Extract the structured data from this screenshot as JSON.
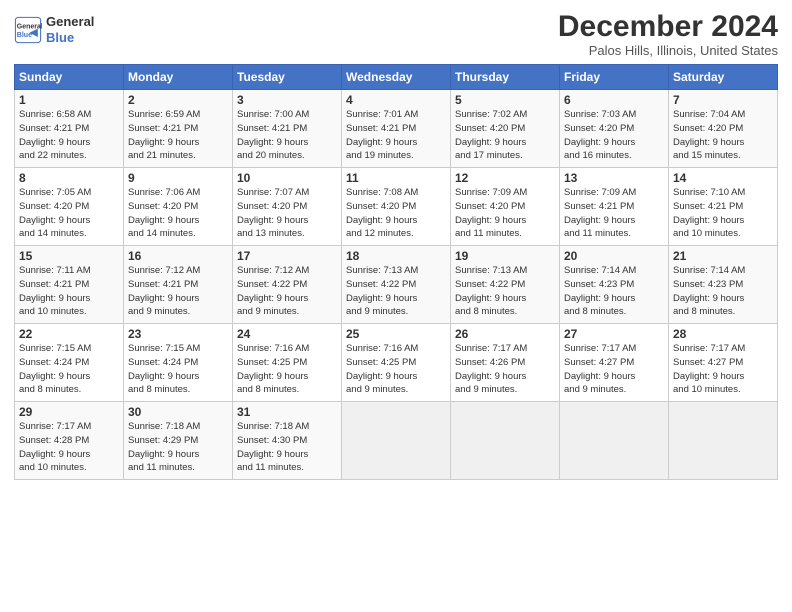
{
  "header": {
    "logo_line1": "General",
    "logo_line2": "Blue",
    "title": "December 2024",
    "location": "Palos Hills, Illinois, United States"
  },
  "days_of_week": [
    "Sunday",
    "Monday",
    "Tuesday",
    "Wednesday",
    "Thursday",
    "Friday",
    "Saturday"
  ],
  "weeks": [
    [
      {
        "day": "1",
        "info": "Sunrise: 6:58 AM\nSunset: 4:21 PM\nDaylight: 9 hours\nand 22 minutes."
      },
      {
        "day": "2",
        "info": "Sunrise: 6:59 AM\nSunset: 4:21 PM\nDaylight: 9 hours\nand 21 minutes."
      },
      {
        "day": "3",
        "info": "Sunrise: 7:00 AM\nSunset: 4:21 PM\nDaylight: 9 hours\nand 20 minutes."
      },
      {
        "day": "4",
        "info": "Sunrise: 7:01 AM\nSunset: 4:21 PM\nDaylight: 9 hours\nand 19 minutes."
      },
      {
        "day": "5",
        "info": "Sunrise: 7:02 AM\nSunset: 4:20 PM\nDaylight: 9 hours\nand 17 minutes."
      },
      {
        "day": "6",
        "info": "Sunrise: 7:03 AM\nSunset: 4:20 PM\nDaylight: 9 hours\nand 16 minutes."
      },
      {
        "day": "7",
        "info": "Sunrise: 7:04 AM\nSunset: 4:20 PM\nDaylight: 9 hours\nand 15 minutes."
      }
    ],
    [
      {
        "day": "8",
        "info": "Sunrise: 7:05 AM\nSunset: 4:20 PM\nDaylight: 9 hours\nand 14 minutes."
      },
      {
        "day": "9",
        "info": "Sunrise: 7:06 AM\nSunset: 4:20 PM\nDaylight: 9 hours\nand 14 minutes."
      },
      {
        "day": "10",
        "info": "Sunrise: 7:07 AM\nSunset: 4:20 PM\nDaylight: 9 hours\nand 13 minutes."
      },
      {
        "day": "11",
        "info": "Sunrise: 7:08 AM\nSunset: 4:20 PM\nDaylight: 9 hours\nand 12 minutes."
      },
      {
        "day": "12",
        "info": "Sunrise: 7:09 AM\nSunset: 4:20 PM\nDaylight: 9 hours\nand 11 minutes."
      },
      {
        "day": "13",
        "info": "Sunrise: 7:09 AM\nSunset: 4:21 PM\nDaylight: 9 hours\nand 11 minutes."
      },
      {
        "day": "14",
        "info": "Sunrise: 7:10 AM\nSunset: 4:21 PM\nDaylight: 9 hours\nand 10 minutes."
      }
    ],
    [
      {
        "day": "15",
        "info": "Sunrise: 7:11 AM\nSunset: 4:21 PM\nDaylight: 9 hours\nand 10 minutes."
      },
      {
        "day": "16",
        "info": "Sunrise: 7:12 AM\nSunset: 4:21 PM\nDaylight: 9 hours\nand 9 minutes."
      },
      {
        "day": "17",
        "info": "Sunrise: 7:12 AM\nSunset: 4:22 PM\nDaylight: 9 hours\nand 9 minutes."
      },
      {
        "day": "18",
        "info": "Sunrise: 7:13 AM\nSunset: 4:22 PM\nDaylight: 9 hours\nand 9 minutes."
      },
      {
        "day": "19",
        "info": "Sunrise: 7:13 AM\nSunset: 4:22 PM\nDaylight: 9 hours\nand 8 minutes."
      },
      {
        "day": "20",
        "info": "Sunrise: 7:14 AM\nSunset: 4:23 PM\nDaylight: 9 hours\nand 8 minutes."
      },
      {
        "day": "21",
        "info": "Sunrise: 7:14 AM\nSunset: 4:23 PM\nDaylight: 9 hours\nand 8 minutes."
      }
    ],
    [
      {
        "day": "22",
        "info": "Sunrise: 7:15 AM\nSunset: 4:24 PM\nDaylight: 9 hours\nand 8 minutes."
      },
      {
        "day": "23",
        "info": "Sunrise: 7:15 AM\nSunset: 4:24 PM\nDaylight: 9 hours\nand 8 minutes."
      },
      {
        "day": "24",
        "info": "Sunrise: 7:16 AM\nSunset: 4:25 PM\nDaylight: 9 hours\nand 8 minutes."
      },
      {
        "day": "25",
        "info": "Sunrise: 7:16 AM\nSunset: 4:25 PM\nDaylight: 9 hours\nand 9 minutes."
      },
      {
        "day": "26",
        "info": "Sunrise: 7:17 AM\nSunset: 4:26 PM\nDaylight: 9 hours\nand 9 minutes."
      },
      {
        "day": "27",
        "info": "Sunrise: 7:17 AM\nSunset: 4:27 PM\nDaylight: 9 hours\nand 9 minutes."
      },
      {
        "day": "28",
        "info": "Sunrise: 7:17 AM\nSunset: 4:27 PM\nDaylight: 9 hours\nand 10 minutes."
      }
    ],
    [
      {
        "day": "29",
        "info": "Sunrise: 7:17 AM\nSunset: 4:28 PM\nDaylight: 9 hours\nand 10 minutes."
      },
      {
        "day": "30",
        "info": "Sunrise: 7:18 AM\nSunset: 4:29 PM\nDaylight: 9 hours\nand 11 minutes."
      },
      {
        "day": "31",
        "info": "Sunrise: 7:18 AM\nSunset: 4:30 PM\nDaylight: 9 hours\nand 11 minutes."
      },
      {
        "day": "",
        "info": ""
      },
      {
        "day": "",
        "info": ""
      },
      {
        "day": "",
        "info": ""
      },
      {
        "day": "",
        "info": ""
      }
    ]
  ]
}
